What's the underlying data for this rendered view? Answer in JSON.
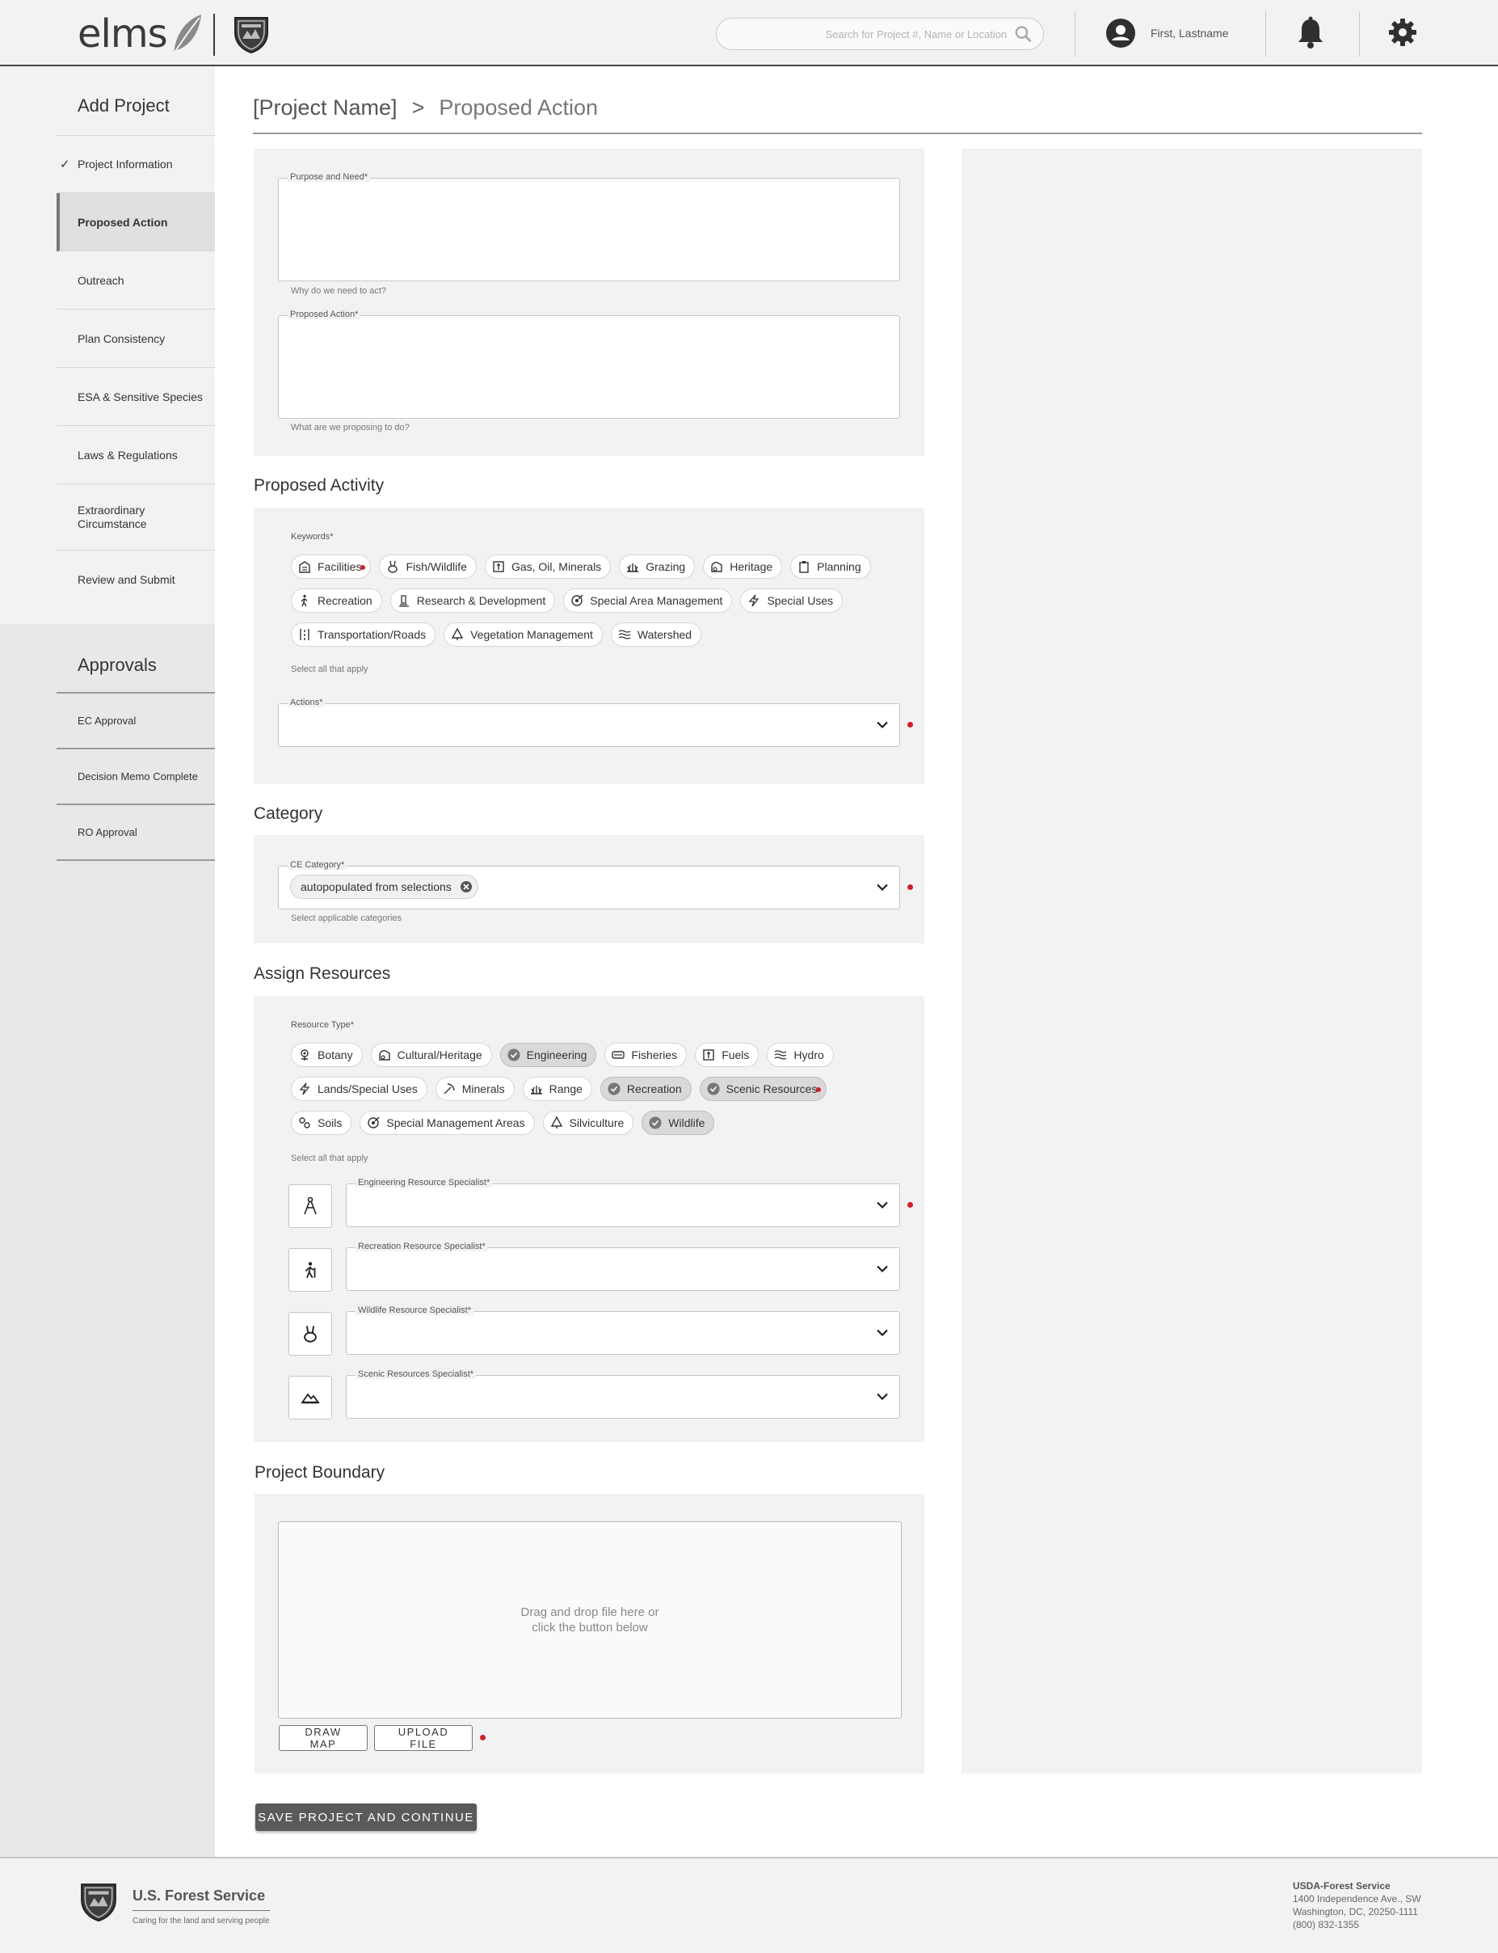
{
  "header": {
    "brand": "elms",
    "search_placeholder": "Search for Project #, Name or Location",
    "user_name": "First, Lastname"
  },
  "sidebar": {
    "heading": "Add Project",
    "items": [
      {
        "label": "Project Information",
        "completed": true
      },
      {
        "label": "Proposed Action",
        "active": true
      },
      {
        "label": "Outreach"
      },
      {
        "label": "Plan Consistency"
      },
      {
        "label": "ESA & Sensitive Species"
      },
      {
        "label": "Laws & Regulations"
      },
      {
        "label": "Extraordinary Circumstance"
      },
      {
        "label": "Review and Submit"
      }
    ],
    "approvals_heading": "Approvals",
    "approvals": [
      {
        "label": "EC Approval"
      },
      {
        "label": "Decision Memo Complete"
      },
      {
        "label": "RO Approval"
      }
    ]
  },
  "breadcrumb": {
    "project": "[Project Name]",
    "separator": ">",
    "current": "Proposed Action"
  },
  "purpose": {
    "label": "Purpose and Need*",
    "helper": "Why do we need to act?",
    "value": ""
  },
  "proposed_action": {
    "label": "Proposed Action*",
    "helper": "What are we proposing to do?",
    "value": ""
  },
  "activity": {
    "title": "Proposed Activity",
    "keywords_label": "Keywords*",
    "keywords_helper": "Select all that apply",
    "keywords": [
      {
        "label": "Facilities",
        "icon": "building-icon",
        "flag": true
      },
      {
        "label": "Fish/Wildlife",
        "icon": "rabbit-icon"
      },
      {
        "label": "Gas, Oil, Minerals",
        "icon": "drill-icon"
      },
      {
        "label": "Grazing",
        "icon": "grass-icon"
      },
      {
        "label": "Heritage",
        "icon": "heritage-icon"
      },
      {
        "label": "Planning",
        "icon": "clipboard-icon"
      },
      {
        "label": "Recreation",
        "icon": "hiker-icon"
      },
      {
        "label": "Research & Development",
        "icon": "microscope-icon"
      },
      {
        "label": "Special Area Management",
        "icon": "target-icon"
      },
      {
        "label": "Special Uses",
        "icon": "lightning-icon"
      },
      {
        "label": "Transportation/Roads",
        "icon": "road-icon"
      },
      {
        "label": "Vegetation Management",
        "icon": "tree-icon"
      },
      {
        "label": "Watershed",
        "icon": "waves-icon"
      }
    ],
    "actions_label": "Actions*",
    "actions_value": ""
  },
  "category": {
    "title": "Category",
    "label": "CE Category*",
    "selected_tag": "autopopulated from selections",
    "helper": "Select applicable categories"
  },
  "resources": {
    "title": "Assign Resources",
    "type_label": "Resource Type*",
    "helper": "Select all that apply",
    "types": [
      {
        "label": "Botany",
        "icon": "flower-icon"
      },
      {
        "label": "Cultural/Heritage",
        "icon": "heritage-icon"
      },
      {
        "label": "Engineering",
        "icon": "check-circle-icon",
        "selected": true
      },
      {
        "label": "Fisheries",
        "icon": "fish-icon"
      },
      {
        "label": "Fuels",
        "icon": "fuel-icon"
      },
      {
        "label": "Hydro",
        "icon": "waves-icon"
      },
      {
        "label": "Lands/Special Uses",
        "icon": "lightning-icon"
      },
      {
        "label": "Minerals",
        "icon": "pickaxe-icon"
      },
      {
        "label": "Range",
        "icon": "grass-icon"
      },
      {
        "label": "Recreation",
        "icon": "check-circle-icon",
        "selected": true
      },
      {
        "label": "Scenic Resources",
        "icon": "check-circle-icon",
        "selected": true,
        "flag": true
      },
      {
        "label": "Soils",
        "icon": "soil-icon"
      },
      {
        "label": "Special Management Areas",
        "icon": "target-icon"
      },
      {
        "label": "Silviculture",
        "icon": "tree-icon"
      },
      {
        "label": "Wildlife",
        "icon": "check-circle-icon",
        "selected": true
      }
    ],
    "specialists": [
      {
        "label": "Engineering Resource Specialist*",
        "icon": "compass-icon",
        "flag": true
      },
      {
        "label": "Recreation Resource Specialist*",
        "icon": "hiker-icon"
      },
      {
        "label": "Wildlife Resource Specialist*",
        "icon": "rabbit-icon"
      },
      {
        "label": "Scenic Resources Specialist*",
        "icon": "mountain-icon"
      }
    ]
  },
  "boundary": {
    "title": "Project Boundary",
    "drop_line1": "Drag and drop file here or",
    "drop_line2": "click the button below",
    "draw_map": "DRAW MAP",
    "upload_file": "UPLOAD FILE"
  },
  "save_button": "SAVE PROJECT AND CONTINUE",
  "footer": {
    "name": "U.S. Forest Service",
    "tagline": "Caring for the land and serving people",
    "address": [
      "USDA-Forest Service",
      "1400 Independence Ave., SW",
      "Washington, DC, 20250-1111",
      "(800) 832-1355"
    ]
  },
  "colors": {
    "accent_red": "#d0202a",
    "primary_button": "#5a5a5a",
    "panel_bg": "#f2f2f2"
  }
}
